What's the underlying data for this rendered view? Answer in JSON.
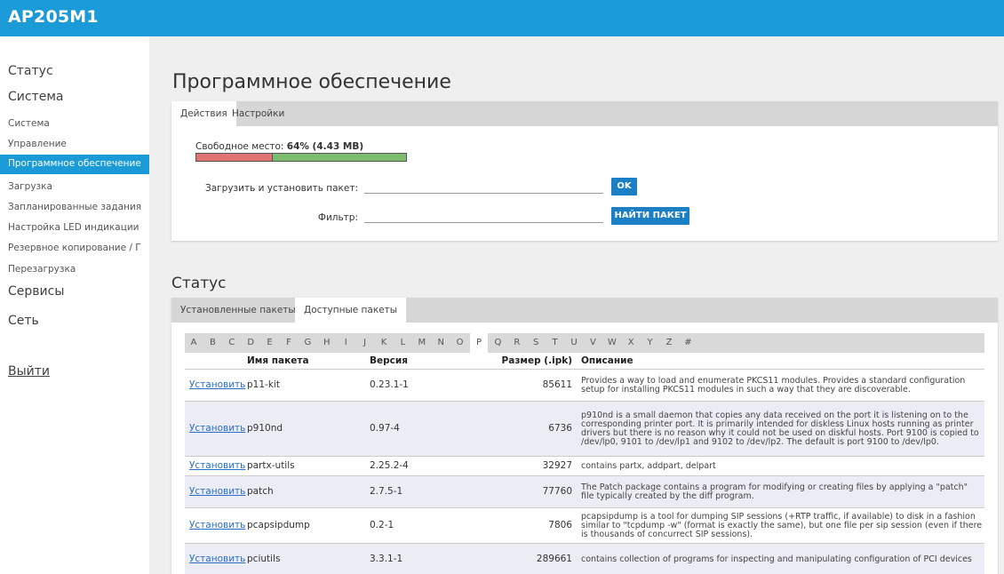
{
  "app": {
    "title": "AP205M1"
  },
  "sidebar": {
    "status": "Статус",
    "system": "Система",
    "items": [
      "Система",
      "Управление",
      "Программное обеспечение",
      "Загрузка",
      "Запланированные задания",
      "Настройка LED индикации",
      "Резервное копирование / Г",
      "Перезагрузка"
    ],
    "services": "Сервисы",
    "network": "Сеть",
    "logout": "Выйти"
  },
  "main": {
    "title": "Программное обеспечение",
    "tabs": [
      "Действия",
      "Настройки"
    ],
    "free_label": "Свободное место:",
    "free_value": "64% (4.43 MB)",
    "free_fraction": 0.36,
    "upload_label": "Загрузить и установить пакет:",
    "upload_button": "OK",
    "filter_label": "Фильтр:",
    "filter_button": "НАЙТИ ПАКЕТ"
  },
  "status": {
    "title": "Статус",
    "tabs": [
      "Установленные пакеты",
      "Доступные пакеты"
    ],
    "letters": [
      "A",
      "B",
      "C",
      "D",
      "E",
      "F",
      "G",
      "H",
      "I",
      "J",
      "K",
      "L",
      "M",
      "N",
      "O",
      "P",
      "Q",
      "R",
      "S",
      "T",
      "U",
      "V",
      "W",
      "X",
      "Y",
      "Z",
      "#"
    ],
    "active_letter": "P",
    "headers": {
      "name": "Имя пакета",
      "version": "Версия",
      "size": "Размер (.ipk)",
      "desc": "Описание"
    },
    "install_label": "Установить",
    "rows": [
      {
        "name": "p11-kit",
        "version": "0.23.1-1",
        "size": "85611",
        "desc": "Provides a way to load and enumerate PKCS11 modules. Provides a standard configuration setup for installing PKCS11 modules in such a way that they are discoverable."
      },
      {
        "name": "p910nd",
        "version": "0.97-4",
        "size": "6736",
        "desc": "p910nd is a small daemon that copies any data received on the port it is listening on to the corresponding printer port. It is primarily intended for diskless Linux hosts running as printer drivers but there is no reason why it could not be used on diskful hosts. Port 9100 is copied to /dev/lp0, 9101 to /dev/lp1 and 9102 to /dev/lp2. The default is port 9100 to /dev/lp0."
      },
      {
        "name": "partx-utils",
        "version": "2.25.2-4",
        "size": "32927",
        "desc": "contains partx, addpart, delpart"
      },
      {
        "name": "patch",
        "version": "2.7.5-1",
        "size": "77760",
        "desc": "The Patch package contains a program for modifying or creating files by applying a \"patch\" file typically created by the diff program."
      },
      {
        "name": "pcapsipdump",
        "version": "0.2-1",
        "size": "7806",
        "desc": "pcapsipdump is a tool for dumping SIP sessions (+RTP traffic, if available) to disk in a fashion similar to \"tcpdump -w\" (format is exactly the same), but one file per sip session (even if there is thousands of concurrect SIP sessions)."
      },
      {
        "name": "pciutils",
        "version": "3.3.1-1",
        "size": "289661",
        "desc": "contains collection of programs for inspecting and manipulating configuration of PCI devices"
      }
    ]
  }
}
